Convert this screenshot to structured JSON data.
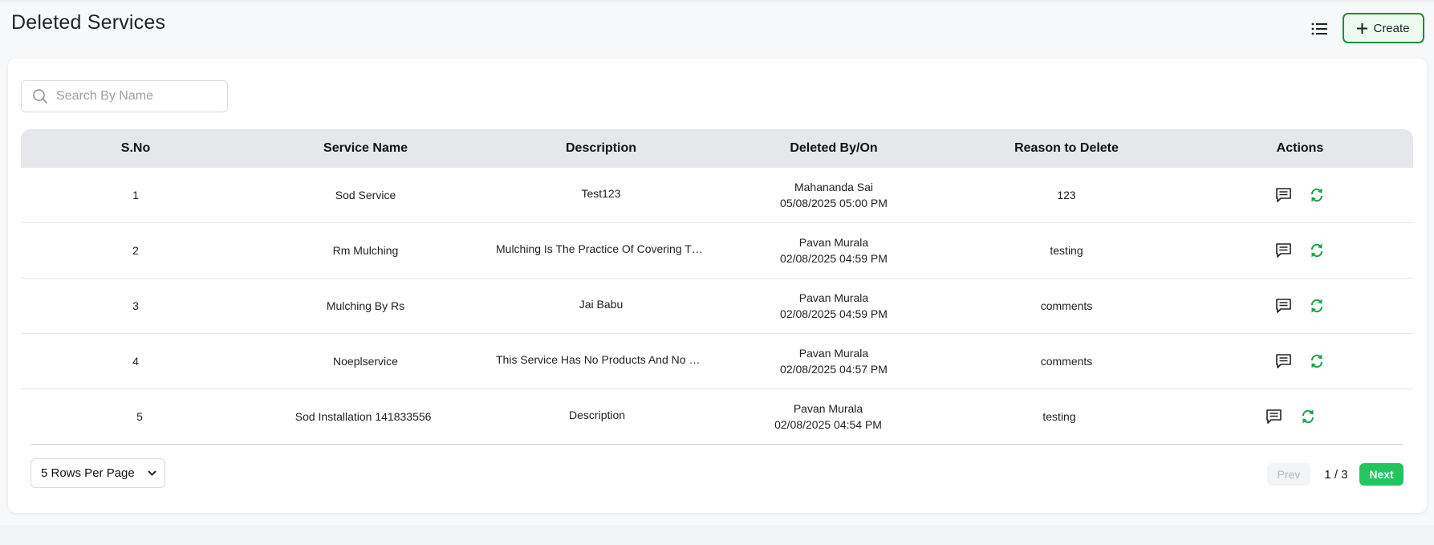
{
  "header": {
    "title": "Deleted Services",
    "create_label": "Create",
    "list_icon": "list-icon",
    "create_icon": "plus-icon"
  },
  "search": {
    "placeholder": "Search By Name",
    "value": "",
    "icon": "search-icon"
  },
  "table": {
    "columns": [
      "S.No",
      "Service Name",
      "Description",
      "Deleted By/On",
      "Reason to Delete",
      "Actions"
    ],
    "rows": [
      {
        "sno": "1",
        "service_name": "Sod Service",
        "description": "Test123",
        "deleted_by": "Mahananda Sai",
        "deleted_on": "05/08/2025 05:00 PM",
        "reason": "123"
      },
      {
        "sno": "2",
        "service_name": "Rm Mulching",
        "description": "Mulching Is The Practice Of Covering The Soil",
        "deleted_by": "Pavan Murala",
        "deleted_on": "02/08/2025 04:59 PM",
        "reason": "testing"
      },
      {
        "sno": "3",
        "service_name": "Mulching By Rs",
        "description": "Jai Babu",
        "deleted_by": "Pavan Murala",
        "deleted_on": "02/08/2025 04:59 PM",
        "reason": "comments"
      },
      {
        "sno": "4",
        "service_name": "Noeplservice",
        "description": "This Service Has No Products And No Equipment",
        "deleted_by": "Pavan Murala",
        "deleted_on": "02/08/2025 04:57 PM",
        "reason": "comments"
      },
      {
        "sno": "5",
        "service_name": "Sod Installation 141833556",
        "description": "Description",
        "deleted_by": "Pavan Murala",
        "deleted_on": "02/08/2025 04:54 PM",
        "reason": "testing"
      }
    ],
    "action_icons": [
      "comment-icon",
      "restore-icon"
    ]
  },
  "pagination": {
    "rows_per_page": "5 Rows Per Page",
    "prev_label": "Prev",
    "page_indicator": "1 / 3",
    "next_label": "Next"
  },
  "colors": {
    "accent_green": "#22c55e",
    "create_border": "#1e8e3e",
    "restore_icon": "#16a34a",
    "header_bg": "#e5e7eb"
  }
}
